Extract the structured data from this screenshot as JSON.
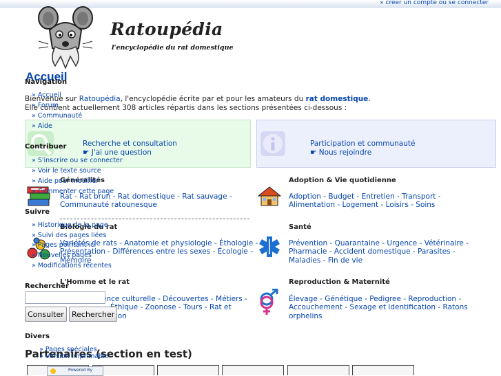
{
  "header": {
    "account_link": "» créer un compte ou se connecter",
    "site_title": "Ratoupédia",
    "tagline": "l'encyclopédie du rat domestique"
  },
  "sidebar": {
    "navigation": {
      "title": "Navigation",
      "items": [
        "» Accueil",
        "» Forum",
        "» Communauté",
        "» Aide"
      ]
    },
    "contribuer": {
      "title": "Contribuer",
      "items": [
        "» S'inscrire ou se connecter",
        "» Voir le texte source",
        "» Aide pour modifier",
        "» Commenter cette page"
      ]
    },
    "suivre": {
      "title": "Suivre",
      "items": [
        "» Historique de la page",
        "» Suivi des pages liées",
        "» Pages pointant ici",
        "» Nouvelles pages",
        "» Modifications récentes"
      ]
    },
    "rechercher": {
      "title": "Rechercher",
      "search_value": "",
      "consult_button": "Consulter",
      "search_button": "Rechercher"
    },
    "divers": {
      "title": "Divers",
      "items": [
        "» Pages spéciales",
        "» Version imprimable"
      ]
    },
    "powered_by": "Powered By"
  },
  "content": {
    "title": "Accueil",
    "intro_pre": "Bienvenue sur ",
    "intro_site_link": "Ratoupédia",
    "intro_mid": ", l'encyclopédie écrite par et pour les amateurs du ",
    "intro_rat_link": "rat domestique",
    "intro_end": ".",
    "intro_line2": "Elle contient actuellement 308 articles répartis dans les sections présentées ci-dessous :",
    "box_research": {
      "title": "Recherche et consultation",
      "sub": "☛ J'ai une question"
    },
    "box_particip": {
      "title": "Participation et communauté",
      "sub": "☛ Nous rejoindre"
    },
    "sections": {
      "generalites": {
        "title": "Généralités",
        "line1": "Rat - Rat brun - Rat domestique - Rat sauvage -",
        "line2": "Communauté ratounesque"
      },
      "adoption": {
        "title": "Adoption & Vie quotidienne",
        "line1": "Adoption - Budget - Entretien - Transport -",
        "line2": "Alimentation - Logement - Loisirs - Soins"
      },
      "biologie": {
        "title": "Biologie du rat",
        "line1": "Variétés de rats - Anatomie et physiologie - Éthologie -",
        "line2": "Présentation - Différences entre les sexes - Écologie -",
        "line3": "Mémoire"
      },
      "sante": {
        "title": "Santé",
        "line1": "Prévention - Quarantaine - Urgence - Vétérinaire -",
        "line2": "Pharmacie - Accident domestique - Parasites -",
        "line3": "Maladies - Fin de vie"
      },
      "homme": {
        "title": "L'Homme et le rat",
        "line1": "Influence culturelle - Découvertes - Métiers -",
        "line2": "Éthique - Zoonose - Tours - Rat et",
        "line3": "création"
      },
      "reproduction": {
        "title": "Reproduction & Maternité",
        "line1": "Élevage - Génétique - Pedigree - Reproduction -",
        "line2": "Accouchement - Sexage et identification - Ratons",
        "line3": "orphelins"
      }
    },
    "partners_title": "Partenaires (section en test)"
  },
  "colors": {
    "link": "#0645ad",
    "research_box_bg": "#e8fae8",
    "particip_box_bg": "#eceffc"
  }
}
